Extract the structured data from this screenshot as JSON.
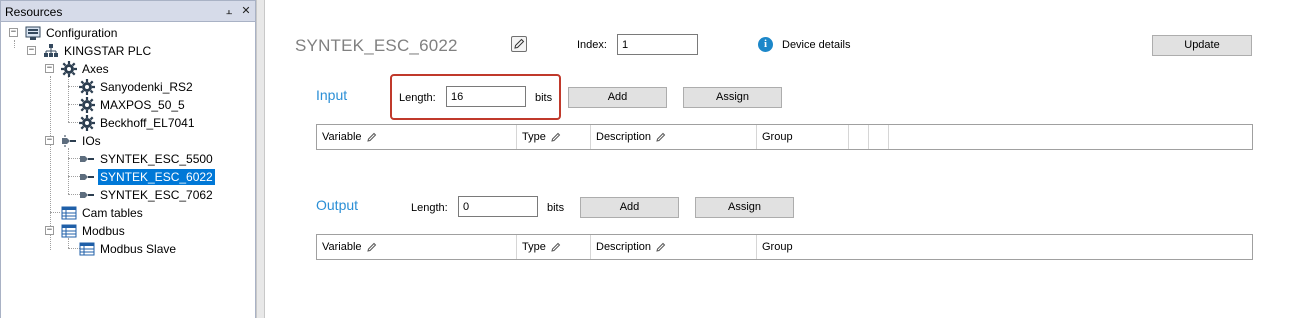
{
  "resources": {
    "title": "Resources",
    "pin_glyph": "⫠",
    "close_glyph": "✕",
    "tree": {
      "configuration": "Configuration",
      "plc": "KINGSTAR PLC",
      "axes": "Axes",
      "axis_items": [
        "Sanyodenki_RS2",
        "MAXPOS_50_5",
        "Beckhoff_EL7041"
      ],
      "ios": "IOs",
      "io_items": [
        "SYNTEK_ESC_5500",
        "SYNTEK_ESC_6022",
        "SYNTEK_ESC_7062"
      ],
      "selected_io": "SYNTEK_ESC_6022",
      "cam_tables": "Cam tables",
      "modbus": "Modbus",
      "modbus_items": [
        "Modbus Slave"
      ],
      "expander_glyph": "−"
    }
  },
  "device": {
    "title": "SYNTEK_ESC_6022",
    "index_label": "Index:",
    "index_value": "1",
    "info_glyph": "i",
    "details_label": "Device details",
    "update_label": "Update"
  },
  "input": {
    "title": "Input",
    "length_label": "Length:",
    "length_value": "16",
    "unit": "bits",
    "add_label": "Add",
    "assign_label": "Assign",
    "columns": [
      "Variable",
      "Type",
      "Description",
      "Group"
    ]
  },
  "output": {
    "title": "Output",
    "length_label": "Length:",
    "length_value": "0",
    "unit": "bits",
    "add_label": "Add",
    "assign_label": "Assign",
    "columns": [
      "Variable",
      "Type",
      "Description",
      "Group"
    ]
  },
  "colors": {
    "accent": "#2b8fd6",
    "selection": "#0078d7",
    "highlight_border": "#c0392b",
    "info": "#1c87c9"
  }
}
